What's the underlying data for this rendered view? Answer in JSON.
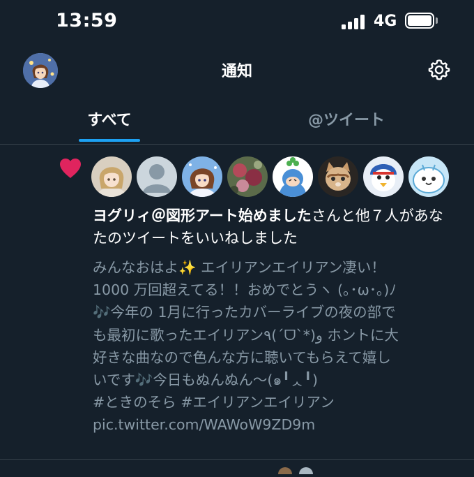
{
  "status_bar": {
    "time": "13:59",
    "network": "4G",
    "battery_level": 0.95
  },
  "header": {
    "title": "通知"
  },
  "tabs": [
    {
      "label": "すべて",
      "active": true
    },
    {
      "label": "@ツイート",
      "active": false
    }
  ],
  "notification": {
    "type": "like",
    "actor_name": "ヨグリィ＠図形アート始めました",
    "summary_suffix": "さんと他７人があなたのツイートをいいねしました",
    "liker_avatars": [
      "avatar-anime-blonde",
      "avatar-default",
      "avatar-idol",
      "avatar-flowers",
      "avatar-clover-character",
      "avatar-kitten",
      "avatar-penguin-character",
      "avatar-blue-mascot"
    ],
    "tweet_text": "みんなおはよ✨ エイリアンエイリアン凄い！\n1000 万回超えてる！！おめでとうヽ (｡･ω･｡)ﾉ\n🎶今年の 1月に行ったカバーライブの夜の部で\nも最初に歌ったエイリアン٩(ˊᗜˋ*)و ホントに大\n好きな曲なので色んな方に聴いてもらえて嬉し\nいです🎶今日もぬんぬん～(๑╹ᆺ╹)\n#ときのそら #エイリアンエイリアン\npic.twitter.com/WAWoW9ZD9m"
  },
  "colors": {
    "background": "#15202b",
    "accent": "#1da1f2",
    "heart": "#e0245e",
    "secondary_text": "#8899a6",
    "divider": "#38444d"
  }
}
